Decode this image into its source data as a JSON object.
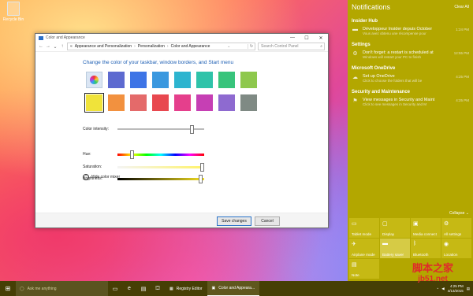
{
  "desktop": {
    "recycle_bin": "Recycle Bin"
  },
  "window": {
    "title": "Color and Appearance",
    "breadcrumb": [
      "«",
      "Appearance and Personalization",
      "Personalization",
      "Color and Appearance"
    ],
    "search_placeholder": "Search Control Panel",
    "heading": "Change the color of your taskbar, window borders, and Start menu",
    "swatches": [
      "#dbe6f4",
      "#5d6ad0",
      "#3d74e6",
      "#3a98df",
      "#2db4cf",
      "#2fc3a9",
      "#38c47b",
      "#8ec84d",
      "#f0e33a",
      "#f2913f",
      "#e46a6a",
      "#e8484f",
      "#e53f8c",
      "#c63fb4",
      "#8e6ad0",
      "#7f8a84"
    ],
    "color_intensity_label": "Color intensity:",
    "mixer_toggle": "Hide color mixer",
    "hue_label": "Hue:",
    "saturation_label": "Saturation:",
    "brightness_label": "Brightness:",
    "save_label": "Save changes",
    "cancel_label": "Cancel"
  },
  "action_center": {
    "title": "Notifications",
    "clear_all": "Clear All",
    "groups": [
      {
        "title": "Insider Hub",
        "items": [
          {
            "icon": "megaphone-icon",
            "glyph": "▬",
            "title": "Développeur Insider depuis October",
            "sub": "Vous avez obtenu une récompense pour",
            "time": "1:24 PM"
          }
        ]
      },
      {
        "title": "Settings",
        "items": [
          {
            "icon": "gear-icon",
            "glyph": "⚙",
            "title": "Don't forget: a restart is scheduled at",
            "sub": "Windows will restart your PC to finish",
            "time": "12:55 PM"
          }
        ]
      },
      {
        "title": "Microsoft OneDrive",
        "items": [
          {
            "icon": "cloud-icon",
            "glyph": "☁",
            "title": "Set up OneDrive",
            "sub": "Click to choose the folders that will be",
            "time": "4:25 PM"
          }
        ]
      },
      {
        "title": "Security and Maintenance",
        "items": [
          {
            "icon": "flag-icon",
            "glyph": "⚑",
            "title": "View messages in Security and Maint",
            "sub": "Click to see messages in Security and M",
            "time": "4:25 PM"
          }
        ]
      }
    ],
    "collapse": "Collapse",
    "tiles": [
      {
        "label": "Tablet mode",
        "icon": "tablet-icon",
        "glyph": "▭",
        "on": false
      },
      {
        "label": "Display",
        "icon": "display-icon",
        "glyph": "▢",
        "on": false
      },
      {
        "label": "Media connect",
        "icon": "media-icon",
        "glyph": "▣",
        "on": false
      },
      {
        "label": "All settings",
        "icon": "gear-icon",
        "glyph": "⚙",
        "on": false
      },
      {
        "label": "Airplane mode",
        "icon": "airplane-icon",
        "glyph": "✈",
        "on": false
      },
      {
        "label": "Battery saver",
        "icon": "battery-icon",
        "glyph": "▬",
        "on": true
      },
      {
        "label": "Bluetooth",
        "icon": "bluetooth-icon",
        "glyph": "ᛒ",
        "on": false
      },
      {
        "label": "Location",
        "icon": "location-icon",
        "glyph": "◉",
        "on": false
      },
      {
        "label": "Note",
        "icon": "note-icon",
        "glyph": "▤",
        "on": false
      }
    ]
  },
  "taskbar": {
    "cortana_placeholder": "Ask me anything",
    "apps": [
      {
        "label": "Registry Editor",
        "icon": "registry-icon"
      },
      {
        "label": "Color and Appeara...",
        "icon": "control-panel-icon"
      }
    ],
    "time": "4:25 PM",
    "date": "4/13/2015"
  },
  "watermark": {
    "line1": "脚本之家",
    "line2": "jb51.net"
  }
}
